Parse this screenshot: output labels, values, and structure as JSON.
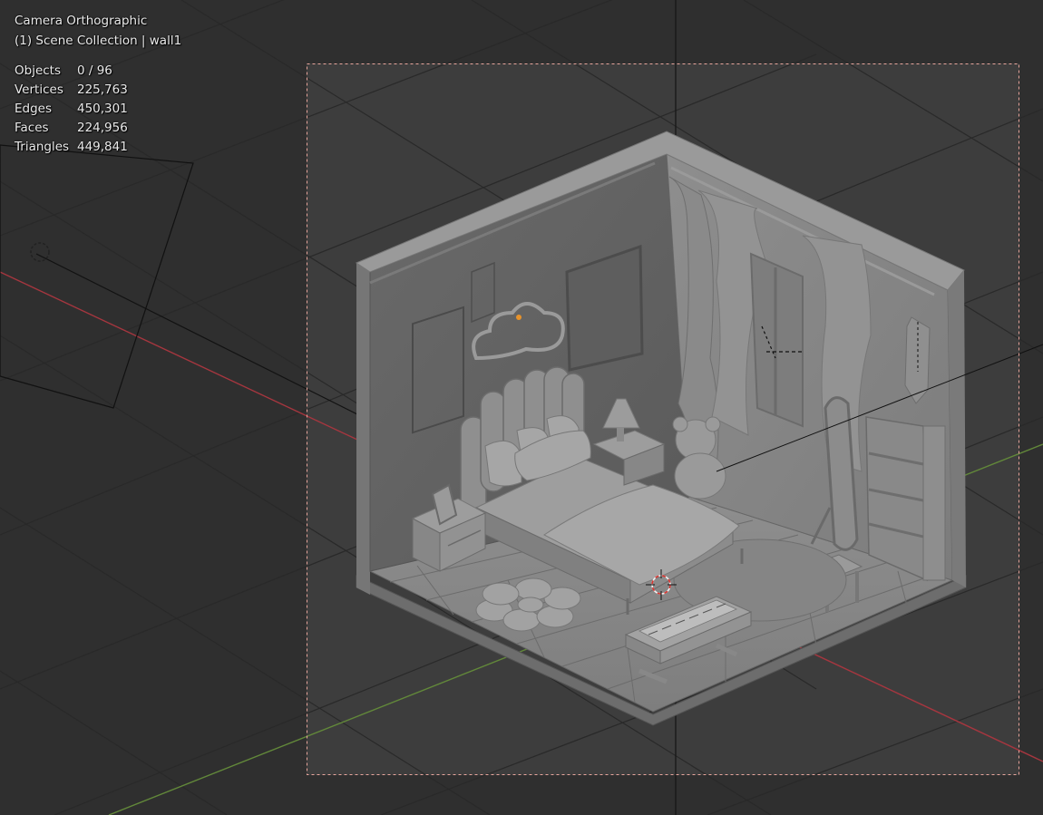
{
  "viewport": {
    "view_name": "Camera Orthographic",
    "collection_info": "(1) Scene Collection | wall1"
  },
  "stats": [
    {
      "label": "Objects",
      "value": "0 / 96"
    },
    {
      "label": "Vertices",
      "value": "225,763"
    },
    {
      "label": "Edges",
      "value": "450,301"
    },
    {
      "label": "Faces",
      "value": "224,956"
    },
    {
      "label": "Triangles",
      "value": "449,841"
    }
  ],
  "colors": {
    "background": "#3b3b3b",
    "grid_line": "#2f2f2f",
    "x_axis": "#a6363f",
    "y_axis": "#62883a",
    "camera_frame": "#e8a59c",
    "model_gray": "#8a8a8a",
    "cursor": "#d8342f"
  },
  "icons": {
    "origin": "origin-dot-icon",
    "cursor": "3d-cursor-icon"
  }
}
